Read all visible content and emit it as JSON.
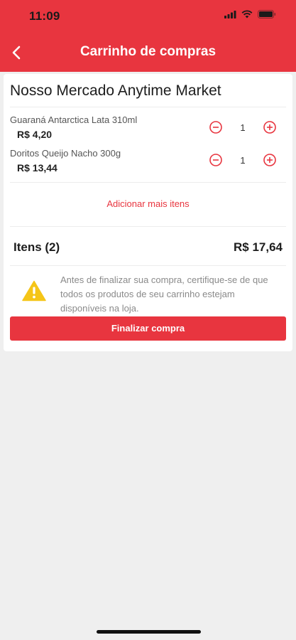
{
  "status_bar": {
    "time": "11:09"
  },
  "header": {
    "title": "Carrinho de compras"
  },
  "cart": {
    "store_name": "Nosso Mercado Anytime Market",
    "items": [
      {
        "name": "Guaraná Antarctica Lata 310ml",
        "price": "R$ 4,20",
        "quantity": "1"
      },
      {
        "name": "Doritos Queijo Nacho 300g",
        "price": "R$ 13,44",
        "quantity": "1"
      }
    ],
    "add_more_label": "Adicionar mais itens",
    "summary": {
      "items_label": "Itens (2)",
      "total": "R$ 17,64"
    },
    "warning": "Antes de finalizar sua compra, certifique-se de que todos os produtos de seu carrinho estejam disponíveis na loja.",
    "finalize_label": "Finalizar compra"
  },
  "colors": {
    "brand": "#e8353f",
    "warning": "#f5c518"
  },
  "icons": [
    "back-icon",
    "minus-icon",
    "plus-icon",
    "warning-icon",
    "wifi-icon",
    "signal-icon",
    "battery-icon"
  ]
}
